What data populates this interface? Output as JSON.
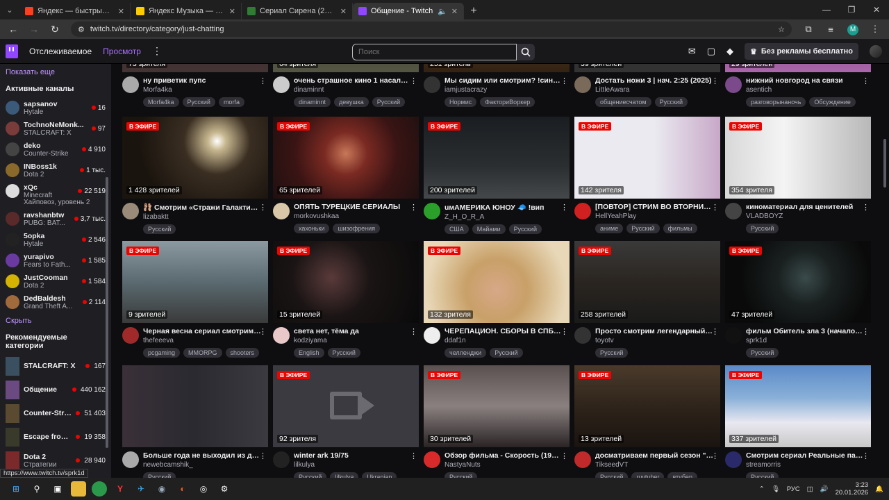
{
  "browser": {
    "tabs": [
      {
        "title": "Яндекс — быстрый поиск в ин",
        "color": "#fc3f1d"
      },
      {
        "title": "Яндекс Музыка — собираем м",
        "color": "#ffcc00"
      },
      {
        "title": "Сериал Сирена (2018) Смотре",
        "color": "#2e7d32"
      },
      {
        "title": "Общение - Twitch",
        "color": "#9147ff"
      }
    ],
    "url": "twitch.tv/directory/category/just-chatting"
  },
  "topnav": {
    "following": "Отслеживаемое",
    "browse": "Просмотр",
    "search_placeholder": "Поиск",
    "prime_label": "Без рекламы бесплатно"
  },
  "sidebar": {
    "show_more": "Показать еще",
    "active_heading": "Активные каналы",
    "channels": [
      {
        "name": "sapsanov",
        "game": "Hytale",
        "viewers": "16",
        "color": "#3b5a7a"
      },
      {
        "name": "TochnoNeMonk...",
        "game": "STALCRAFT: X",
        "viewers": "97",
        "color": "#7a3b3b"
      },
      {
        "name": "deko",
        "game": "Counter-Strike",
        "viewers": "4 910",
        "color": "#444"
      },
      {
        "name": "INBoss1k",
        "game": "Dota 2",
        "viewers": "1 тыс.",
        "color": "#8a6a2a"
      },
      {
        "name": "xQc",
        "game": "Minecraft",
        "viewers": "22 519",
        "color": "#ddd"
      },
      {
        "name": "",
        "game": "Хайповоз, уровень 2",
        "viewers": "",
        "color": ""
      },
      {
        "name": "ravshanbtw",
        "game": "PUBG: BAT...",
        "viewers": "3,7 тыс.",
        "color": "#5a2a2a"
      },
      {
        "name": "5opka",
        "game": "Hytale",
        "viewers": "2 546",
        "color": "#222"
      },
      {
        "name": "yurapivo",
        "game": "Fears to Fath...",
        "viewers": "1 585",
        "color": "#6a3aa0"
      },
      {
        "name": "JustCooman",
        "game": "Dota 2",
        "viewers": "1 584",
        "color": "#d4b400"
      },
      {
        "name": "DedBaldesh",
        "game": "Grand Theft A...",
        "viewers": "2 114",
        "color": "#a06a3a"
      }
    ],
    "hide": "Скрыть",
    "rec_heading": "Рекомендуемые категории",
    "categories": [
      {
        "name": "STALCRAFT: X",
        "sub": "",
        "viewers": "167",
        "color": "#3a5060"
      },
      {
        "name": "Общение",
        "sub": "",
        "viewers": "440 162",
        "color": "#6a4a80"
      },
      {
        "name": "Counter-Strike",
        "sub": "",
        "viewers": "51 403",
        "color": "#5a4a30"
      },
      {
        "name": "Escape from ...",
        "sub": "",
        "viewers": "19 358",
        "color": "#3a3a2a"
      },
      {
        "name": "Dota 2",
        "sub": "Стратегии",
        "viewers": "28 940",
        "color": "#7a2a2a"
      }
    ]
  },
  "live_label": "В ЭФИРЕ",
  "streams": [
    {
      "viewers": "73 зрителя",
      "title": "ну приветик пупс",
      "channel": "Morfa4ka",
      "tags": [
        "Morfa4ka",
        "Русский",
        "morfa"
      ],
      "bg": "linear-gradient(#2a2a33,#433)",
      "av": "#aaa",
      "live": false
    },
    {
      "viewers": "64 зрителя",
      "title": "очень страшное кино 1 насало в ...",
      "channel": "dinaminnt",
      "tags": [
        "dinaminnt",
        "девушка",
        "Русский"
      ],
      "bg": "linear-gradient(#332,#554)",
      "av": "#ccc",
      "live": false
    },
    {
      "viewers": "251 зритель",
      "title": "Мы сидим или смотрим? !синем...",
      "channel": "iamjustacrazy",
      "tags": [
        "Нормис",
        "ФакториВоркер"
      ],
      "bg": "linear-gradient(#654,#321)",
      "av": "#333",
      "live": false
    },
    {
      "viewers": "39 зрителей",
      "title": "Достать ножи 3 | нач. 2:25 (2025)",
      "channel": "LittleAwara",
      "tags": [
        "общениесчатом",
        "Русский"
      ],
      "bg": "linear-gradient(#222,#333)",
      "av": "#7a6a5a",
      "live": false
    },
    {
      "viewers": "29 зрителей",
      "title": "нижний новгород на связи",
      "channel": "asentich",
      "tags": [
        "разговорынаночь",
        "Обсуждение"
      ],
      "bg": "linear-gradient(#535,#a6a)",
      "av": "#7a4a8a",
      "live": false
    },
    {
      "viewers": "1 428 зрителей",
      "title": "🩰 Смотрим «Стражи Галактики...",
      "channel": "lizabaktt",
      "tags": [
        "Русский"
      ],
      "bg": "radial-gradient(circle at 65% 30%,#fff 0,#c8b890 8%,#3a2e22 30%,#1a140e 70%)",
      "av": "#9a8a7a",
      "live": true
    },
    {
      "viewers": "65 зрителей",
      "title": "ОПЯТЬ ТУРЕЦКИЕ СЕРИАЛЫ",
      "channel": "morkovushkaa",
      "tags": [
        "хахоньки",
        "шизофрения"
      ],
      "bg": "radial-gradient(circle at 50% 45%,#c87858 0,#7a2a22 25%,#3a1414 60%,#201010 100%)",
      "av": "#d8c8a8",
      "live": true
    },
    {
      "viewers": "200 зрителей",
      "title": "uмАМЕРИКА ЮНОУ 🧢 !вип",
      "channel": "Z_H_O_R_A",
      "tags": [
        "США",
        "Майами",
        "Русский"
      ],
      "bg": "linear-gradient(#1a1e22,#2a2e30 60%,#45484a)",
      "av": "#2aa02a",
      "live": true
    },
    {
      "viewers": "142 зрителя",
      "title": "[ПОВТОР] СТРИМ ВО ВТОРНИК, ...",
      "channel": "HellYeahPlay",
      "tags": [
        "аниме",
        "Русский",
        "фильмы"
      ],
      "bg": "linear-gradient(90deg,#eaeaf0 0,#eaeaf0 55%,#c8a8c8 100%)",
      "av": "#d02020",
      "live": true
    },
    {
      "viewers": "354 зрителя",
      "title": "киноматериал для ценителей",
      "channel": "VLADBOYZ",
      "tags": [
        "Русский"
      ],
      "bg": "linear-gradient(90deg,#d8d8d8 0,#f4f4f4 40%,#b8b8b8 100%)",
      "av": "#444",
      "live": true
    },
    {
      "viewers": "9 зрителей",
      "title": "Черная весна сериал смотрим, п...",
      "channel": "thefeeeva",
      "tags": [
        "pcgaming",
        "MMORPG",
        "shooters"
      ],
      "bg": "linear-gradient(#8a9aa0,#5a6a70 50%,#3a3a3a)",
      "av": "#a02a2a",
      "live": true
    },
    {
      "viewers": "15 зрителей",
      "title": "света нет, тёма да",
      "channel": "kodziyama",
      "tags": [
        "English",
        "Русский"
      ],
      "bg": "radial-gradient(circle at 40% 45%,#5a3a3a 0,#1a1414 40%,#0a0a0a 100%)",
      "av": "#e8c8c8",
      "live": true
    },
    {
      "viewers": "132 зрителя",
      "title": "ЧЕРЕПАЦИОН. СБОРЫ В СПБ. | !...",
      "channel": "ddaf1n",
      "tags": [
        "челленджи",
        "Русский"
      ],
      "bg": "radial-gradient(circle at 50% 60%,#d8a888 0,#c8a068 35%,#e8d8b8 80%)",
      "av": "#eee",
      "live": true
    },
    {
      "viewers": "258 зрителей",
      "title": "Просто смотрим легендарный ф...",
      "channel": "toyotv",
      "tags": [
        "Русский"
      ],
      "bg": "linear-gradient(#3a3a3a,#2a2520 50%,#1a1a1a)",
      "av": "#333",
      "live": true
    },
    {
      "viewers": "47 зрителей",
      "title": "фильм Обитель зла 3 (начало 3:1...",
      "channel": "sprk1d",
      "tags": [
        "Русский"
      ],
      "bg": "radial-gradient(circle at 55% 45%,#3a4a4a 0,#1a2020 30%,#0a0a0a 70%)",
      "av": "#111",
      "live": true
    },
    {
      "viewers": "",
      "title": "Больше года не выходил из дом...",
      "channel": "newebcamshik_",
      "tags": [
        "Русский"
      ],
      "bg": "linear-gradient(90deg,#3a3038 0,#2a2a30 50%,#3a3a40)",
      "av": "#aaa",
      "live": false
    },
    {
      "viewers": "92 зрителя",
      "title": "winter ark 19/75",
      "channel": "lilkulya",
      "tags": [
        "Русский",
        "lilkulya",
        "Ukranian"
      ],
      "bg": "#3a3a40",
      "av": "#222",
      "live": true
    },
    {
      "viewers": "30 зрителей",
      "title": "Обзор фильма - Скорость (1994)...",
      "channel": "NastyaNuts",
      "tags": [
        "Русский"
      ],
      "bg": "linear-gradient(#5a5050,#8a8080 50%,#2a2424)",
      "av": "#d82a2a",
      "live": true
    },
    {
      "viewers": "13 зрителей",
      "title": "досматриваем первый сезон \"8...",
      "channel": "TikseedVT",
      "tags": [
        "Русский",
        "ruvtuber",
        "втубер"
      ],
      "bg": "linear-gradient(#4a3a2a,#2a2018 60%,#1a1410)",
      "av": "#c02a2a",
      "live": true
    },
    {
      "viewers": "337 зрителей",
      "title": "Смотрим сериал Реальные паца...",
      "channel": "streamorris",
      "tags": [
        "Русский"
      ],
      "bg": "linear-gradient(#5a8ac8,#8ab0d8 40%,#e8e8f0 70%,#c8c8c8)",
      "av": "#2a2a6a",
      "live": true
    }
  ],
  "status_url": "https://www.twitch.tv/sprk1d",
  "taskbar": {
    "lang": "РУС",
    "time": "3:23",
    "date": "20.01.2026"
  }
}
